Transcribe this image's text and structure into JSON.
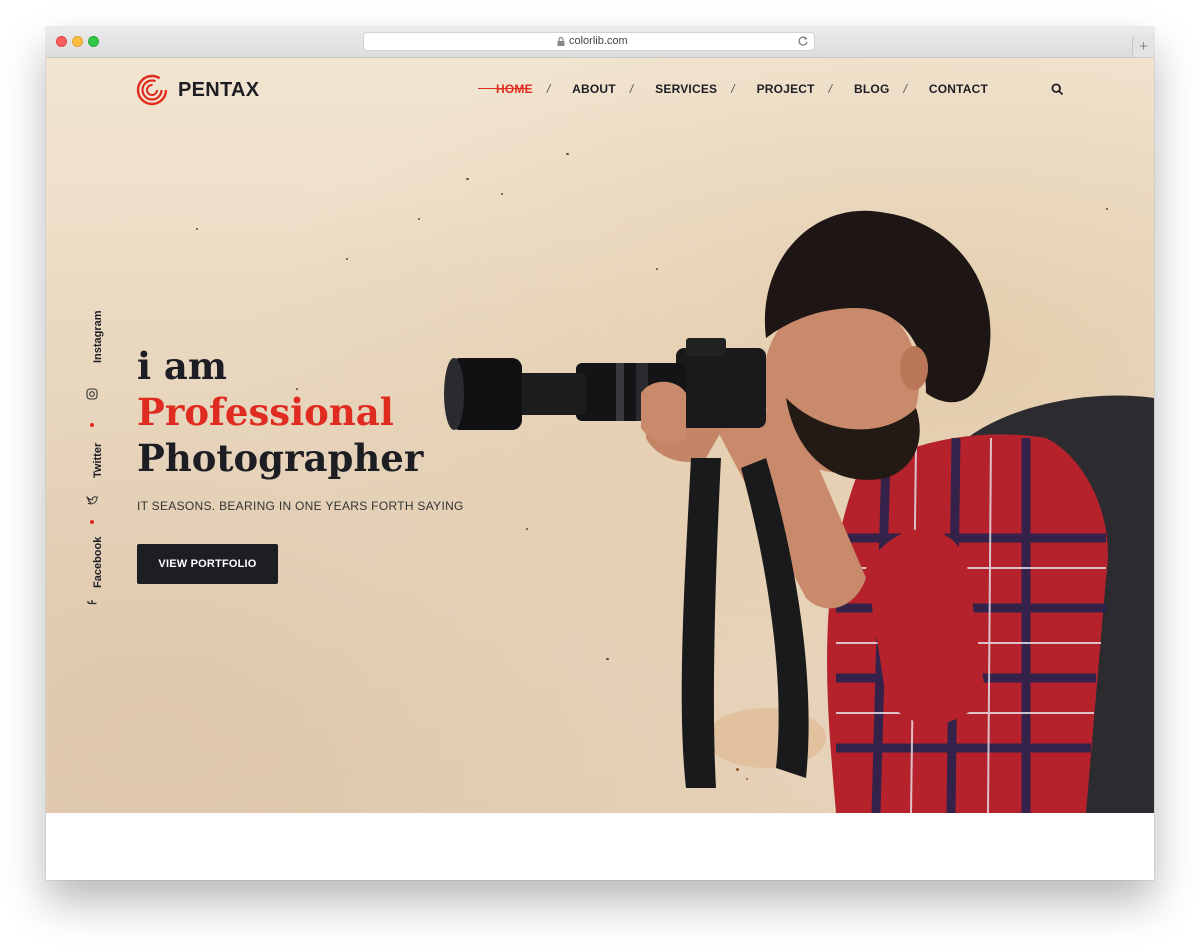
{
  "browser": {
    "url": "colorlib.com",
    "new_tab_symbol": "+"
  },
  "brand": {
    "name": "PENTAX",
    "accent_color": "#e02b20",
    "dark_color": "#1d1d24"
  },
  "nav": {
    "items": [
      {
        "label": "HOME",
        "active": true
      },
      {
        "label": "ABOUT",
        "active": false
      },
      {
        "label": "SERVICES",
        "active": false
      },
      {
        "label": "PROJECT",
        "active": false
      },
      {
        "label": "BLOG",
        "active": false
      },
      {
        "label": "CONTACT",
        "active": false
      }
    ],
    "separator": "/",
    "search_icon": "search-icon"
  },
  "social": [
    {
      "label": "Instagram",
      "icon": "instagram-icon"
    },
    {
      "label": "Twitter",
      "icon": "twitter-icon"
    },
    {
      "label": "Facebook",
      "icon": "facebook-icon"
    }
  ],
  "hero": {
    "line1": "i am",
    "line2": "Professional",
    "line3": "Photographer",
    "tagline": "IT SEASONS. BEARING IN ONE YEARS FORTH SAYING",
    "cta_label": "VIEW PORTFOLIO"
  }
}
